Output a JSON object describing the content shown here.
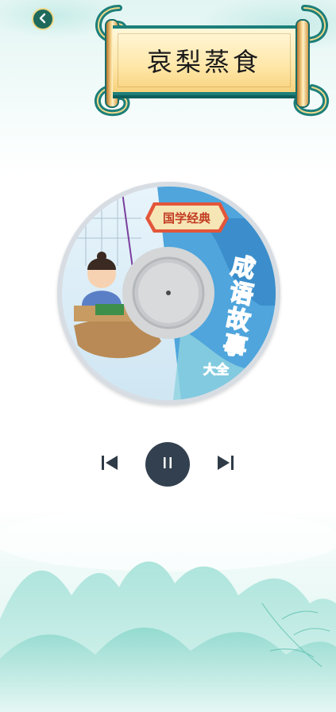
{
  "header": {
    "title": "哀梨蒸食",
    "back_icon": "back-arrow-icon"
  },
  "album_art": {
    "badge": "国学经典",
    "title_chars": [
      "成",
      "语",
      "故",
      "事"
    ],
    "subtitle": "大全"
  },
  "player": {
    "state": "playing",
    "controls": [
      "previous-icon",
      "pause-icon",
      "next-icon"
    ]
  },
  "colors": {
    "accent_teal": "#1d7f7a",
    "gold": "#f0d98a",
    "play_button": "#33404f",
    "title_red": "#e85b1c"
  }
}
